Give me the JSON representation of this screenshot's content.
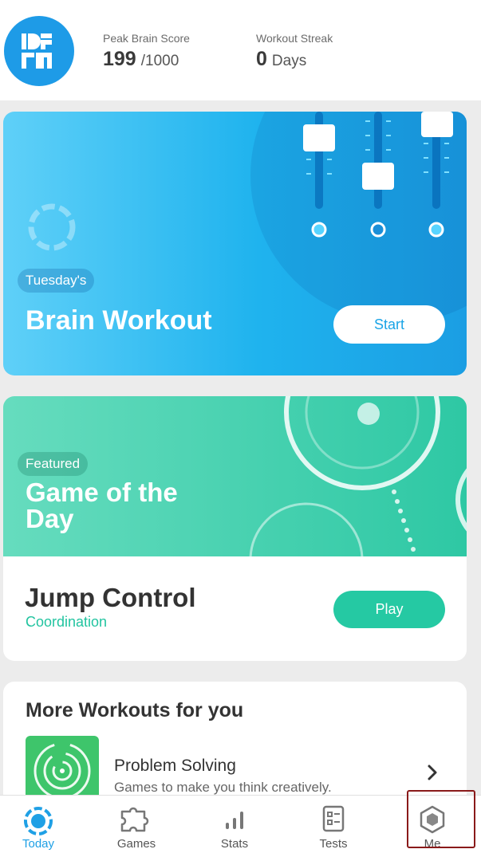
{
  "header": {
    "peak_label": "Peak Brain Score",
    "peak_value": "199",
    "peak_max": "/1000",
    "streak_label": "Workout Streak",
    "streak_value": "0",
    "streak_unit": "Days"
  },
  "workout_card": {
    "day_label": "Tuesday's",
    "title": "Brain Workout",
    "start_label": "Start"
  },
  "game_card": {
    "badge": "Featured",
    "title": "Game of the Day",
    "game_name": "Jump Control",
    "category": "Coordination",
    "play_label": "Play"
  },
  "more_workouts": {
    "title": "More Workouts for you",
    "items": [
      {
        "title": "Problem Solving",
        "subtitle": "Games to make you think creatively."
      }
    ]
  },
  "tabs": [
    {
      "label": "Today",
      "icon": "today-icon",
      "active": true
    },
    {
      "label": "Games",
      "icon": "puzzle-icon",
      "active": false
    },
    {
      "label": "Stats",
      "icon": "bar-chart-icon",
      "active": false
    },
    {
      "label": "Tests",
      "icon": "clipboard-icon",
      "active": false
    },
    {
      "label": "Me",
      "icon": "hexagon-icon",
      "active": false
    }
  ],
  "colors": {
    "brand_blue": "#1e9be7",
    "teal": "#25c9a3",
    "highlight_box": "#8a1a1a"
  }
}
